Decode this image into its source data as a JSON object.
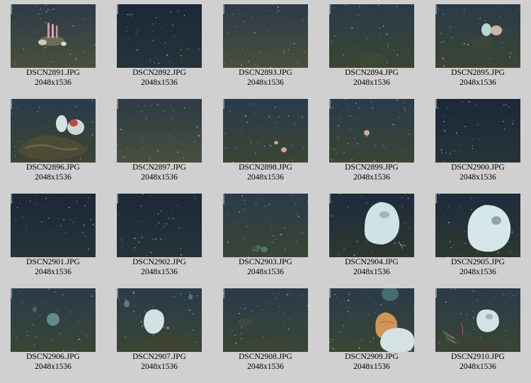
{
  "thumbnails": [
    {
      "filename": "DSCN2891.JPG",
      "dimensions": "2048x1536",
      "scene": "coral-sandy"
    },
    {
      "filename": "DSCN2892.JPG",
      "dimensions": "2048x1536",
      "scene": "dark-floor"
    },
    {
      "filename": "DSCN2893.JPG",
      "dimensions": "2048x1536",
      "scene": "sandy-floor"
    },
    {
      "filename": "DSCN2894.JPG",
      "dimensions": "2048x1536",
      "scene": "rock-floor"
    },
    {
      "filename": "DSCN2895.JPG",
      "dimensions": "2048x1536",
      "scene": "small-sponges"
    },
    {
      "filename": "DSCN2896.JPG",
      "dimensions": "2048x1536",
      "scene": "sponges-on-rock"
    },
    {
      "filename": "DSCN2897.JPG",
      "dimensions": "2048x1536",
      "scene": "speckled-floor"
    },
    {
      "filename": "DSCN2898.JPG",
      "dimensions": "2048x1536",
      "scene": "small-creatures"
    },
    {
      "filename": "DSCN2899.JPG",
      "dimensions": "2048x1536",
      "scene": "single-creature"
    },
    {
      "filename": "DSCN2900.JPG",
      "dimensions": "2048x1536",
      "scene": "dark-floor"
    },
    {
      "filename": "DSCN2901.JPG",
      "dimensions": "2048x1536",
      "scene": "dark-floor"
    },
    {
      "filename": "DSCN2902.JPG",
      "dimensions": "2048x1536",
      "scene": "dark-floor"
    },
    {
      "filename": "DSCN2903.JPG",
      "dimensions": "2048x1536",
      "scene": "green-cluster"
    },
    {
      "filename": "DSCN2904.JPG",
      "dimensions": "2048x1536",
      "scene": "large-sponge"
    },
    {
      "filename": "DSCN2905.JPG",
      "dimensions": "2048x1536",
      "scene": "large-sponge-2"
    },
    {
      "filename": "DSCN2906.JPG",
      "dimensions": "2048x1536",
      "scene": "faint-sponge"
    },
    {
      "filename": "DSCN2907.JPG",
      "dimensions": "2048x1536",
      "scene": "sponge-on-rock"
    },
    {
      "filename": "DSCN2908.JPG",
      "dimensions": "2048x1536",
      "scene": "rocky-floor"
    },
    {
      "filename": "DSCN2909.JPG",
      "dimensions": "2048x1536",
      "scene": "orange-sponge"
    },
    {
      "filename": "DSCN2910.JPG",
      "dimensions": "2048x1536",
      "scene": "sponge-with-coral"
    }
  ]
}
